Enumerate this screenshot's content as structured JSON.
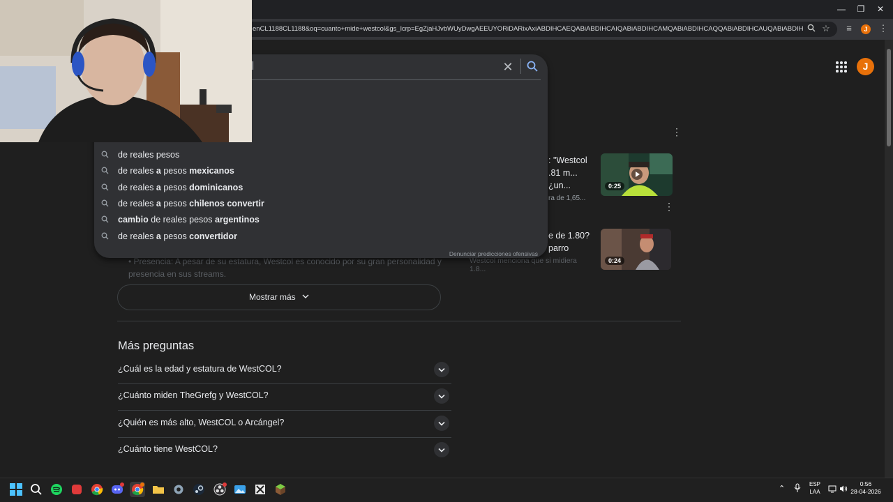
{
  "browser": {
    "url": "enCL1188CL1188&oq=cuanto+mide+westcol&gs_lcrp=EgZjaHJvbWUyDwgAEEUYORiDARixAxiABDIHCAEQABiABDIHCAIQABiABDIHCAMQABiABDIHCAQQABiABDIHCAUQABiABDIHCAYQABi...",
    "profile_initial": "J"
  },
  "account_initial": "J",
  "suggestions": [
    {
      "parts": [
        {
          "t": "de reales pesos",
          "b": false
        }
      ]
    },
    {
      "parts": [
        {
          "t": "de reales ",
          "b": false
        },
        {
          "t": "a",
          "b": true
        },
        {
          "t": " pesos ",
          "b": false
        },
        {
          "t": "mexicanos",
          "b": true
        }
      ]
    },
    {
      "parts": [
        {
          "t": "de reales ",
          "b": false
        },
        {
          "t": "a",
          "b": true
        },
        {
          "t": " pesos ",
          "b": false
        },
        {
          "t": "dominicanos",
          "b": true
        }
      ]
    },
    {
      "parts": [
        {
          "t": "de reales ",
          "b": false
        },
        {
          "t": "a",
          "b": true
        },
        {
          "t": " pesos ",
          "b": false
        },
        {
          "t": "chilenos convertir",
          "b": true
        }
      ]
    },
    {
      "parts": [
        {
          "t": "cambio",
          "b": true
        },
        {
          "t": " de reales pesos ",
          "b": false
        },
        {
          "t": "argentinos",
          "b": true
        }
      ]
    },
    {
      "parts": [
        {
          "t": "de reales ",
          "b": false
        },
        {
          "t": "a",
          "b": true
        },
        {
          "t": " pesos ",
          "b": false
        },
        {
          "t": "convertidor",
          "b": true
        }
      ]
    }
  ],
  "report_link": "Denunciar predicciones ofensivas",
  "faded": {
    "bullet": "Presencia: A pesar de su estatura, Westcol es conocido por su gran personalidad y",
    "bullet2": "presencia en sus streams.",
    "video_sub": "Westcol menciona que si midiera 1.8..."
  },
  "videos": [
    {
      "title1": ": \"Westcol",
      "title2": ".81 m... ¿un...",
      "sub": "ra de 1,65...",
      "duration": "0:25"
    },
    {
      "title1": "e de 1.80?",
      "title2": "parro",
      "sub": "",
      "duration": "0:24"
    }
  ],
  "show_more": "Mostrar más",
  "more_questions": {
    "title": "Más preguntas",
    "items": [
      "¿Cuál es la edad y estatura de WestCOL?",
      "¿Cuánto miden TheGrefg y WestCOL?",
      "¿Quién es más alto, WestCOL o Arcángel?",
      "¿Cuánto tiene WestCOL?"
    ]
  },
  "taskbar": {
    "lang1": "ESP",
    "lang2": "LAA",
    "time": "0:56",
    "date": "28-04-2026"
  },
  "colors": {
    "page_bg": "#1f1f1f",
    "searchbox_bg": "#303134",
    "accent_orange": "#e8710a"
  }
}
